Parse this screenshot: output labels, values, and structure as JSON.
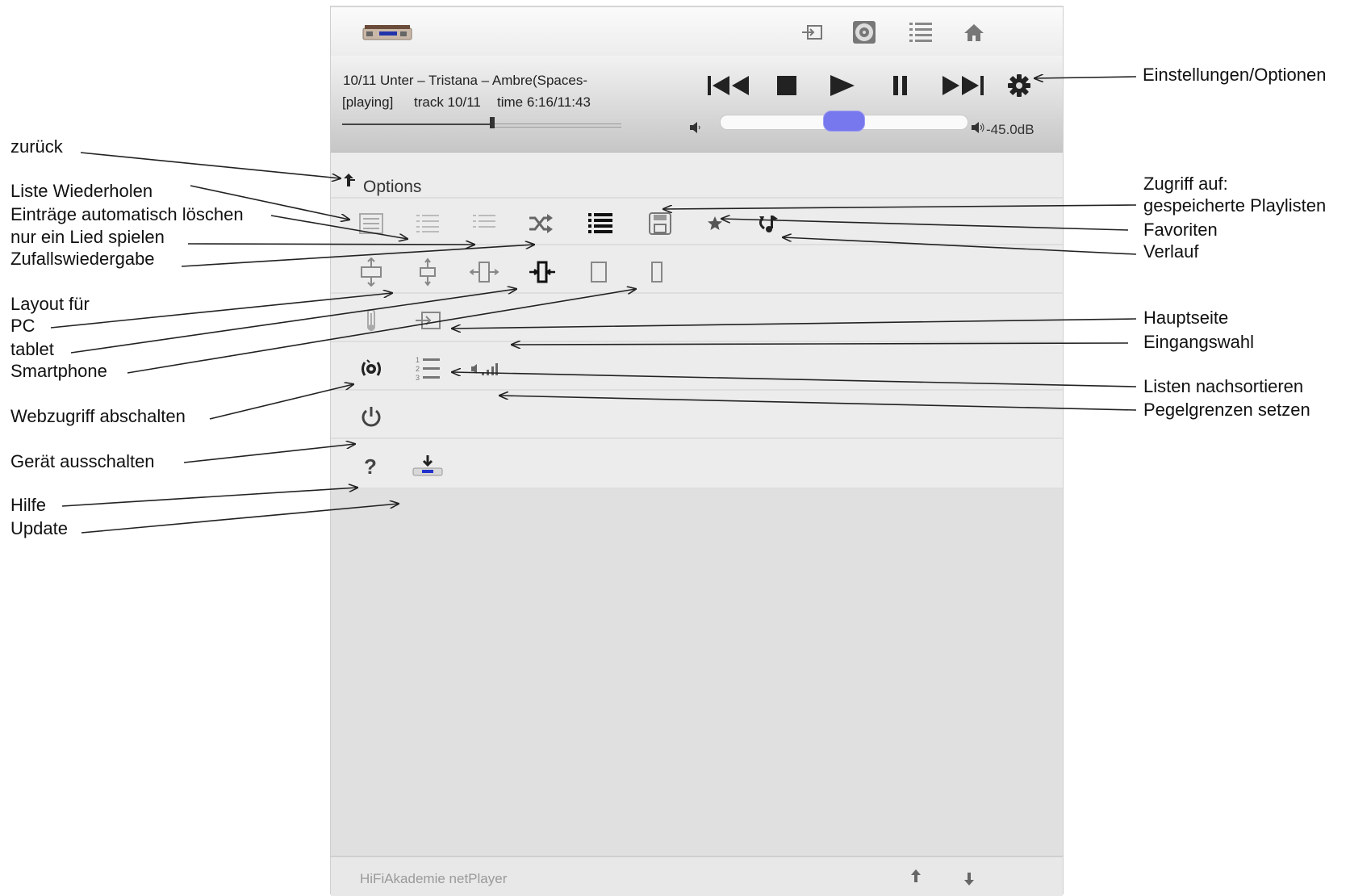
{
  "player": {
    "line1": "10/11 Unter – Tristana – Ambre(Spaces-",
    "status": "[playing]",
    "track": "track 10/11",
    "time": "time 6:16/11:43",
    "progress_fraction": 0.53,
    "volume_fraction": 0.5,
    "volume_readout": "-45.0dB"
  },
  "options": {
    "title": "Options"
  },
  "footer": {
    "label": "HiFiAkademie netPlayer"
  },
  "annotations": {
    "settings": "Einstellungen/Optionen",
    "back": "zurück",
    "repeat": "Liste Wiederholen",
    "autodelete": "Einträge automatisch löschen",
    "single": "nur ein Lied spielen",
    "shuffle": "Zufallswiedergabe",
    "layout": "Layout für",
    "pc": "PC",
    "tablet": "tablet",
    "smartphone": "Smartphone",
    "webaccess": "Webzugriff abschalten",
    "poweroff": "Gerät ausschalten",
    "help": "Hilfe",
    "update": "Update",
    "saved_access": "Zugriff auf:",
    "saved_playlists": "gespeicherte Playlisten",
    "favorites": "Favoriten",
    "history": "Verlauf",
    "mainpage": "Hauptseite",
    "input": "Eingangswahl",
    "resort": "Listen nachsortieren",
    "levels": "Pegelgrenzen setzen"
  },
  "colors": {
    "volume_thumb": "#7777ee",
    "panel_bg": "#ececec",
    "page_bg": "#e0e0e0"
  }
}
